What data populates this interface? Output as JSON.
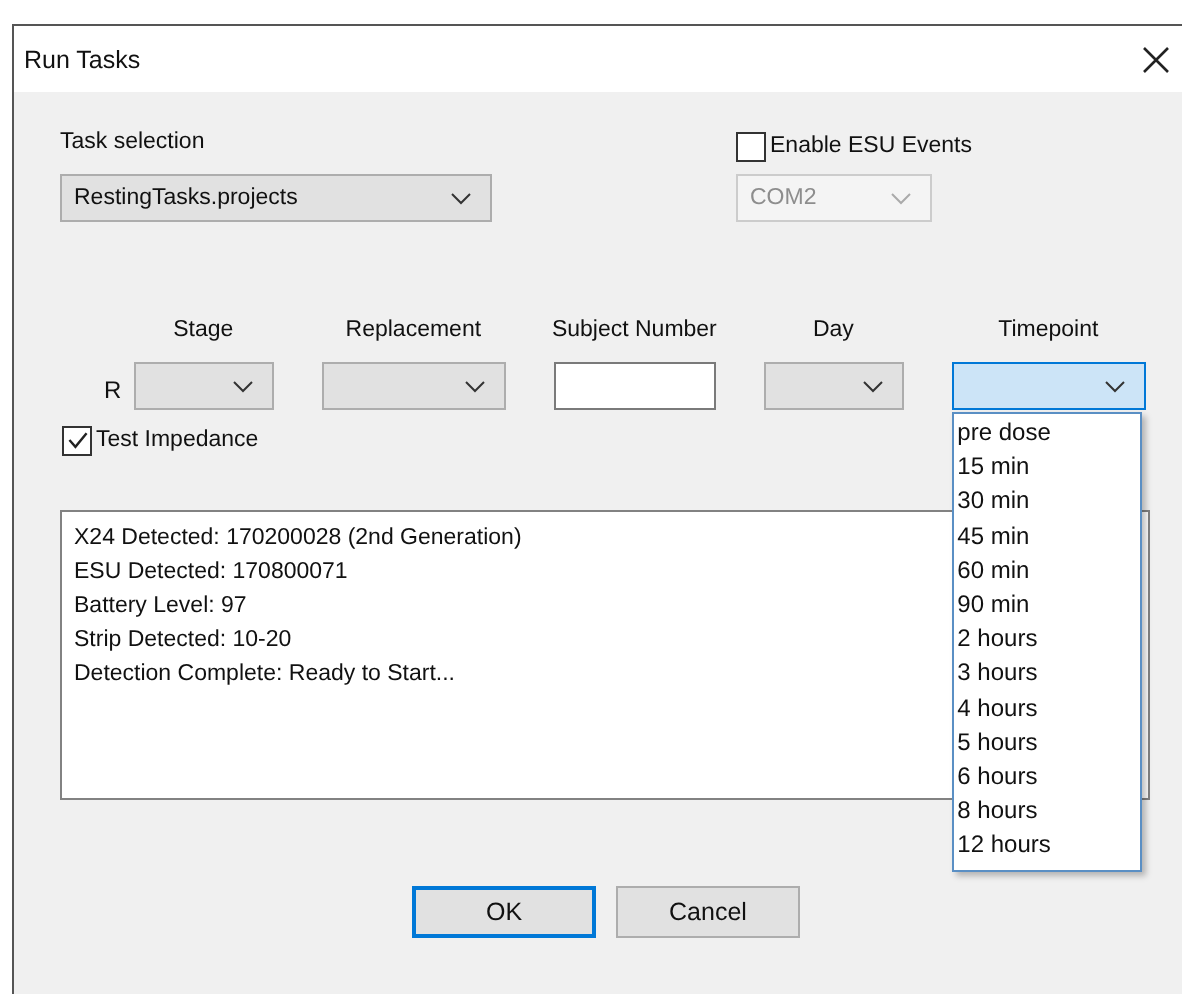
{
  "window": {
    "title": "Run Tasks"
  },
  "task_selection": {
    "label": "Task selection",
    "value": "RestingTasks.projects"
  },
  "esu": {
    "label": "Enable ESU Events",
    "checked": false,
    "port": "COM2",
    "port_disabled": true
  },
  "fields": [
    {
      "kind": "combo",
      "label": "Stage",
      "prefix": "R",
      "focused": false
    },
    {
      "kind": "combo",
      "label": "Replacement",
      "focused": false
    },
    {
      "kind": "input",
      "label": "Subject Number"
    },
    {
      "kind": "combo",
      "label": "Day",
      "focused": false
    },
    {
      "kind": "combo",
      "label": "Timepoint",
      "focused": true
    }
  ],
  "timepoint_list": [
    "pre dose",
    "15 min",
    "30 min",
    "45 min",
    "60 min",
    "90 min",
    "2 hours",
    "3 hours",
    "4 hours",
    "5 hours",
    "6 hours",
    "8 hours",
    "12 hours"
  ],
  "test_impedance": {
    "label": "Test Impedance",
    "checked": true
  },
  "log": [
    "X24 Detected: 170200028 (2nd Generation)",
    "ESU Detected: 170800071",
    "Battery Level: 97",
    "Strip Detected: 10-20",
    "Detection Complete: Ready to Start..."
  ],
  "buttons": [
    {
      "label": "OK",
      "default": true
    },
    {
      "label": "Cancel",
      "default": false
    }
  ]
}
